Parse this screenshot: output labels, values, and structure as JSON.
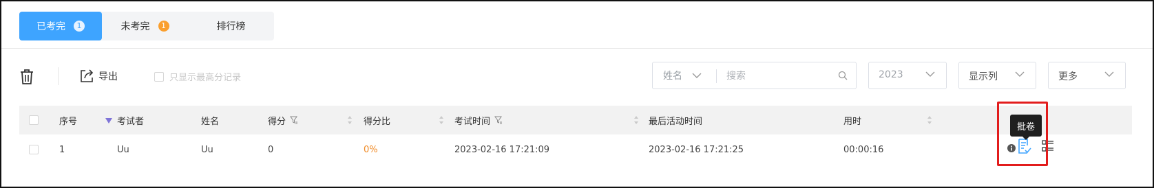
{
  "tabs": [
    {
      "label": "已考完",
      "badge": "1"
    },
    {
      "label": "未考完",
      "badge": "1"
    },
    {
      "label": "排行榜"
    }
  ],
  "toolbar": {
    "delete_icon": "trash-icon",
    "export_label": "导出",
    "export_icon": "export-icon",
    "max_score_only_label": "只显示最高分记录"
  },
  "search": {
    "field": "姓名",
    "placeholder": "搜索",
    "icon": "search-icon"
  },
  "year_select": {
    "value": "2023"
  },
  "columns_select": {
    "value": "显示列"
  },
  "more_select": {
    "value": "更多"
  },
  "table": {
    "columns": [
      "序号",
      "考试者",
      "姓名",
      "得分",
      "得分比",
      "考试时间",
      "最后活动时间",
      "用时"
    ],
    "rows": [
      {
        "index": "1",
        "examinee": "Uu",
        "name": "Uu",
        "score": "0",
        "score_ratio": "0%",
        "exam_time": "2023-02-16 17:21:09",
        "last_activity": "2023-02-16 17:21:25",
        "duration": "00:00:16"
      }
    ]
  },
  "tooltip": {
    "text": "批卷"
  },
  "colors": {
    "accent": "#3ea4ff",
    "badge_orange": "#fa9f2e",
    "score_ratio": "#f08a24",
    "highlight": "#e21c1c"
  }
}
